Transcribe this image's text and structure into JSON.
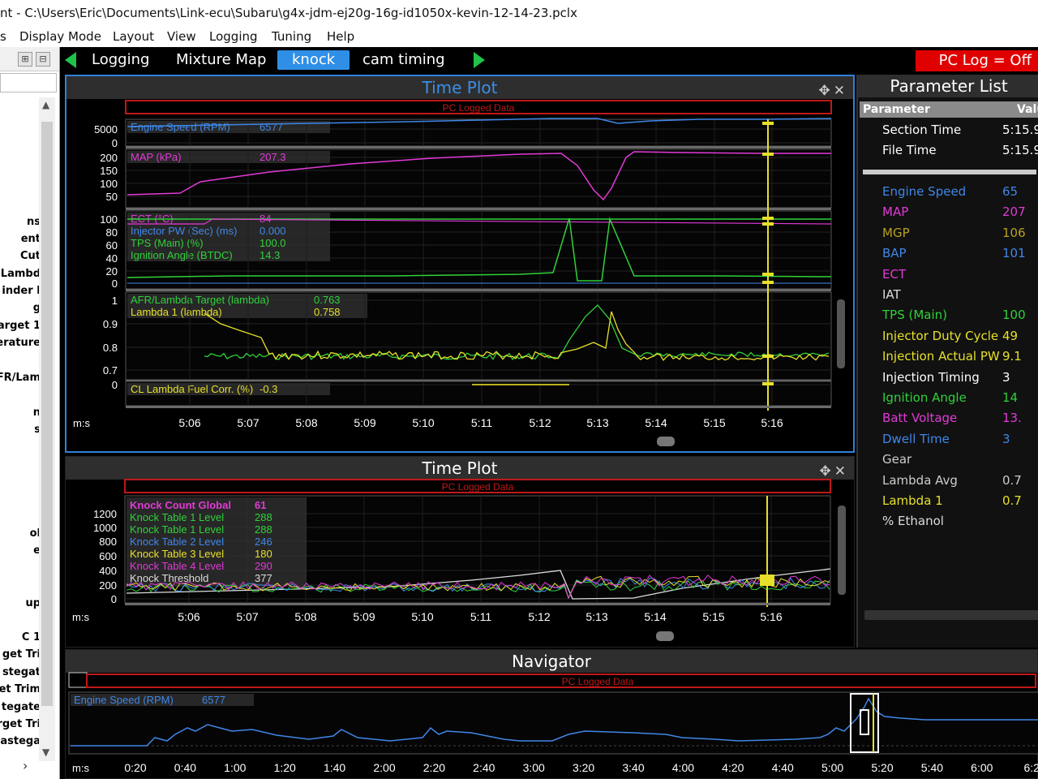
{
  "window": {
    "title": "nt - C:\\Users\\Eric\\Documents\\Link-ecu\\Subaru\\g4x-jdm-ej20g-16g-id1050x-kevin-12-14-23.pclx"
  },
  "menu": [
    "s",
    "Display Mode",
    "Layout",
    "View",
    "Logging",
    "Tuning",
    "Help"
  ],
  "left_pane": {
    "tool_icons": [
      "pin-icon",
      "dock-icon"
    ],
    "items": [
      "ns",
      "ent",
      "Cut",
      "Lambd",
      "inder I",
      "g",
      "arget 1",
      "erature",
      "FR/Lam",
      "n",
      "s",
      "ol",
      "e",
      "up",
      "C 1",
      "get Tri",
      "stegat",
      "et Trim",
      "tegate",
      "rget Tri",
      "astega"
    ],
    "scroll_right": "›"
  },
  "tabs": {
    "items": [
      "Logging",
      "Mixture Map",
      "knock",
      "cam timing"
    ],
    "active": "knock",
    "pc_log": "PC Log = Off"
  },
  "plot1": {
    "title": "Time Plot",
    "banner": "PC Logged Data",
    "time_label": "m:s",
    "time_ticks": [
      "5:06",
      "5:07",
      "5:08",
      "5:09",
      "5:10",
      "5:11",
      "5:12",
      "5:13",
      "5:14",
      "5:15",
      "5:16"
    ],
    "tracks": [
      {
        "yticks": [
          "5000",
          "0"
        ],
        "labels": [
          {
            "name": "Engine Speed (RPM)",
            "value": "6577",
            "color": "#3f87e8"
          }
        ]
      },
      {
        "yticks": [
          "200",
          "150",
          "100",
          "50"
        ],
        "labels": [
          {
            "name": "MAP (kPa)",
            "value": "207.3",
            "color": "#e23ad8"
          }
        ]
      },
      {
        "yticks": [
          "100",
          "80",
          "60",
          "40",
          "20",
          "0"
        ],
        "labels": [
          {
            "name": "ECT (°C)",
            "value": "84",
            "color": "#e23ad8"
          },
          {
            "name": "Injector PW (Sec) (ms)",
            "value": "0.000",
            "color": "#3f87e8"
          },
          {
            "name": "TPS (Main) (%)",
            "value": "100.0",
            "color": "#2fd13a"
          },
          {
            "name": "Ignition Angle (BTDC)",
            "value": "14.3",
            "color": "#2fd13a"
          }
        ]
      },
      {
        "yticks": [
          "1",
          "0.9",
          "0.8",
          "0.7"
        ],
        "labels": [
          {
            "name": "AFR/Lambda Target (lambda)",
            "value": "0.763",
            "color": "#2fd13a"
          },
          {
            "name": "Lambda 1 (lambda)",
            "value": "0.758",
            "color": "#e6e02a"
          }
        ]
      },
      {
        "yticks": [
          "0"
        ],
        "labels": [
          {
            "name": "CL Lambda Fuel Corr. (%)",
            "value": "-0.3",
            "color": "#e6e02a"
          }
        ]
      }
    ]
  },
  "plot2": {
    "title": "Time Plot",
    "banner": "PC Logged Data",
    "time_label": "m:s",
    "time_ticks": [
      "5:06",
      "5:07",
      "5:08",
      "5:09",
      "5:10",
      "5:11",
      "5:12",
      "5:13",
      "5:14",
      "5:15",
      "5:16"
    ],
    "yticks": [
      "1200",
      "1000",
      "800",
      "600",
      "400",
      "200",
      "0"
    ],
    "labels": [
      {
        "name": "Knock Count Global",
        "value": "61",
        "color": "#e23ad8"
      },
      {
        "name": "Knock Table 1 Level",
        "value": "288",
        "color": "#2fd13a"
      },
      {
        "name": "Knock Table 1 Level",
        "value": "288",
        "color": "#2fd13a"
      },
      {
        "name": "Knock Table 2 Level",
        "value": "246",
        "color": "#3f87e8"
      },
      {
        "name": "Knock Table 3 Level",
        "value": "180",
        "color": "#e6e02a"
      },
      {
        "name": "Knock Table 4 Level",
        "value": "290",
        "color": "#e23ad8"
      },
      {
        "name": "Knock Threshold",
        "value": "377",
        "color": "#dddddd"
      }
    ]
  },
  "navigator": {
    "title": "Navigator",
    "banner": "PC Logged Data",
    "label": {
      "name": "Engine Speed (RPM)",
      "value": "6577",
      "color": "#3f87e8"
    },
    "time_label": "m:s",
    "time_ticks": [
      "0:20",
      "0:40",
      "1:00",
      "1:20",
      "1:40",
      "2:00",
      "2:20",
      "2:40",
      "3:00",
      "3:20",
      "3:40",
      "4:00",
      "4:20",
      "4:40",
      "5:00",
      "5:20",
      "5:40",
      "6:00",
      "6:2"
    ]
  },
  "parameters": {
    "title": "Parameter List",
    "col_name": "Parameter",
    "col_value": "Valu",
    "top_rows": [
      {
        "name": "Section Time",
        "value": "5:15.9",
        "color": "#ffffff"
      },
      {
        "name": "File Time",
        "value": "5:15.9",
        "color": "#ffffff"
      }
    ],
    "rows": [
      {
        "name": "Engine Speed",
        "value": "65",
        "color": "#3f87e8"
      },
      {
        "name": "MAP",
        "value": "207",
        "color": "#e23ad8"
      },
      {
        "name": "MGP",
        "value": "106",
        "color": "#b8a020"
      },
      {
        "name": "BAP",
        "value": "101",
        "color": "#3f87e8"
      },
      {
        "name": "ECT",
        "value": "",
        "color": "#e23ad8"
      },
      {
        "name": "IAT",
        "value": "",
        "color": "#dddddd"
      },
      {
        "name": "TPS (Main)",
        "value": "100",
        "color": "#2fd13a"
      },
      {
        "name": "Injector Duty Cycle",
        "value": "49",
        "color": "#e6e02a"
      },
      {
        "name": "Injection Actual PW",
        "value": "9.1",
        "color": "#e6e02a"
      },
      {
        "name": "Injection Timing",
        "value": "3",
        "color": "#ffffff"
      },
      {
        "name": "Ignition Angle",
        "value": "14",
        "color": "#2fd13a"
      },
      {
        "name": "Batt Voltage",
        "value": "13.",
        "color": "#e23ad8"
      },
      {
        "name": "Dwell Time",
        "value": "3",
        "color": "#3f87e8"
      },
      {
        "name": "Gear",
        "value": "",
        "color": "#cccccc"
      },
      {
        "name": "Lambda Avg",
        "value": "0.7",
        "color": "#cccccc"
      },
      {
        "name": "Lambda 1",
        "value": "0.7",
        "color": "#e6e02a"
      },
      {
        "name": "% Ethanol",
        "value": "",
        "color": "#dddddd"
      }
    ]
  }
}
